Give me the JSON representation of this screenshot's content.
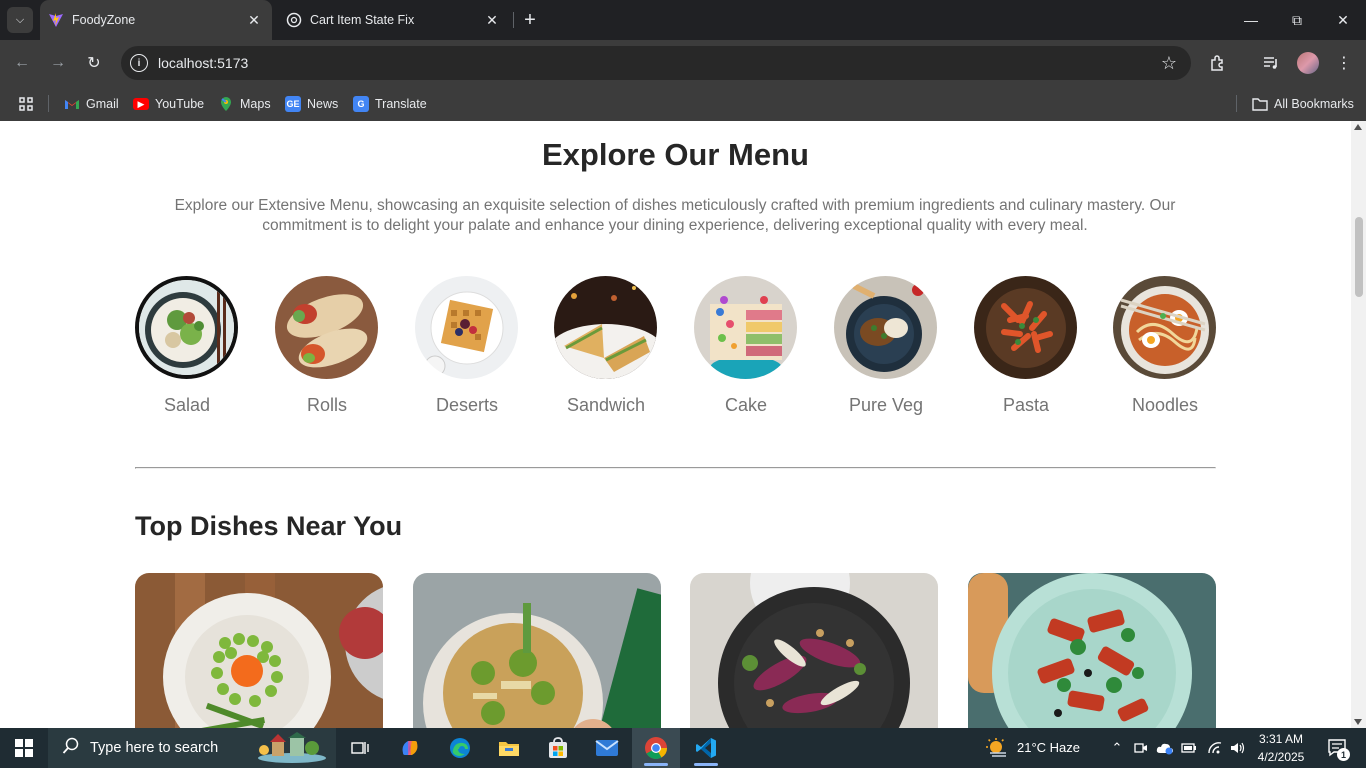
{
  "browser": {
    "tabs": [
      {
        "title": "FoodyZone",
        "active": true
      },
      {
        "title": "Cart Item State Fix",
        "active": false
      }
    ],
    "url": "localhost:5173",
    "bookmarks": [
      {
        "label": "Gmail",
        "icon": "gmail-icon"
      },
      {
        "label": "YouTube",
        "icon": "youtube-icon"
      },
      {
        "label": "Maps",
        "icon": "maps-icon"
      },
      {
        "label": "News",
        "icon": "news-icon"
      },
      {
        "label": "Translate",
        "icon": "translate-icon"
      }
    ],
    "all_bookmarks": "All Bookmarks"
  },
  "menu": {
    "title": "Explore Our Menu",
    "description": "Explore our Extensive Menu, showcasing an exquisite selection of dishes meticulously crafted with premium ingredients and culinary mastery. Our commitment is to delight your palate and enhance your dining experience, delivering exceptional quality with every meal.",
    "items": [
      {
        "label": "Salad"
      },
      {
        "label": "Rolls"
      },
      {
        "label": "Deserts"
      },
      {
        "label": "Sandwich"
      },
      {
        "label": "Cake"
      },
      {
        "label": "Pure Veg"
      },
      {
        "label": "Pasta"
      },
      {
        "label": "Noodles"
      }
    ]
  },
  "dishes": {
    "title": "Top Dishes Near You"
  },
  "taskbar": {
    "search_placeholder": "Type here to search",
    "weather": "21°C  Haze",
    "time": "3:31 AM",
    "date": "4/2/2025",
    "notification_count": "1"
  }
}
